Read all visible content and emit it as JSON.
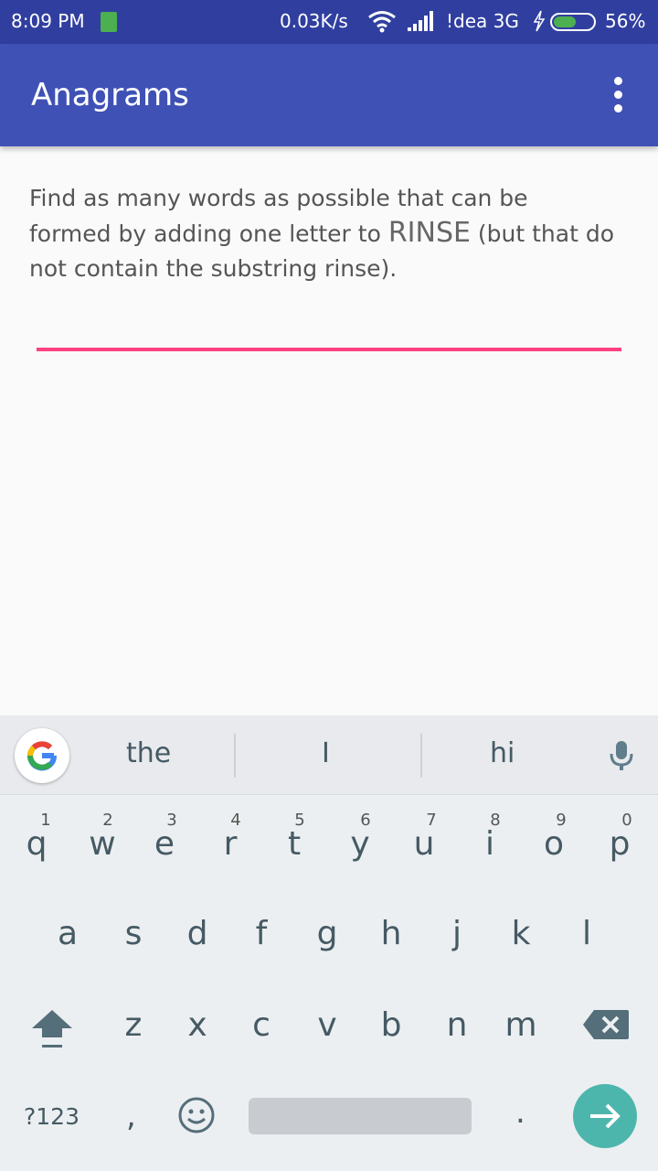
{
  "status_bar": {
    "time": "8:09 PM",
    "speed": "0.03K/s",
    "carrier": "!dea 3G",
    "battery": "56%",
    "battery_level": 0.56
  },
  "app_bar": {
    "title": "Anagrams",
    "menu_icon": "more-vert-icon"
  },
  "prompt": {
    "before": "Find as many words as possible that can be formed by adding one letter to ",
    "word": "RINSE",
    "after": " (but that do not contain the substring rinse)."
  },
  "input": {
    "value": "",
    "accent_color": "#ff4081"
  },
  "keyboard": {
    "suggestions": [
      "the",
      "I",
      "hi"
    ],
    "row1": [
      "q",
      "w",
      "e",
      "r",
      "t",
      "y",
      "u",
      "i",
      "o",
      "p"
    ],
    "row1_hints": [
      "1",
      "2",
      "3",
      "4",
      "5",
      "6",
      "7",
      "8",
      "9",
      "0"
    ],
    "row2": [
      "a",
      "s",
      "d",
      "f",
      "g",
      "h",
      "j",
      "k",
      "l"
    ],
    "row3": [
      "z",
      "x",
      "c",
      "v",
      "b",
      "n",
      "m"
    ],
    "symbols_label": "?123",
    "comma": ",",
    "period": "."
  },
  "colors": {
    "status_bar": "#303f9f",
    "app_bar": "#3f51b5",
    "enter": "#4db6ac"
  }
}
